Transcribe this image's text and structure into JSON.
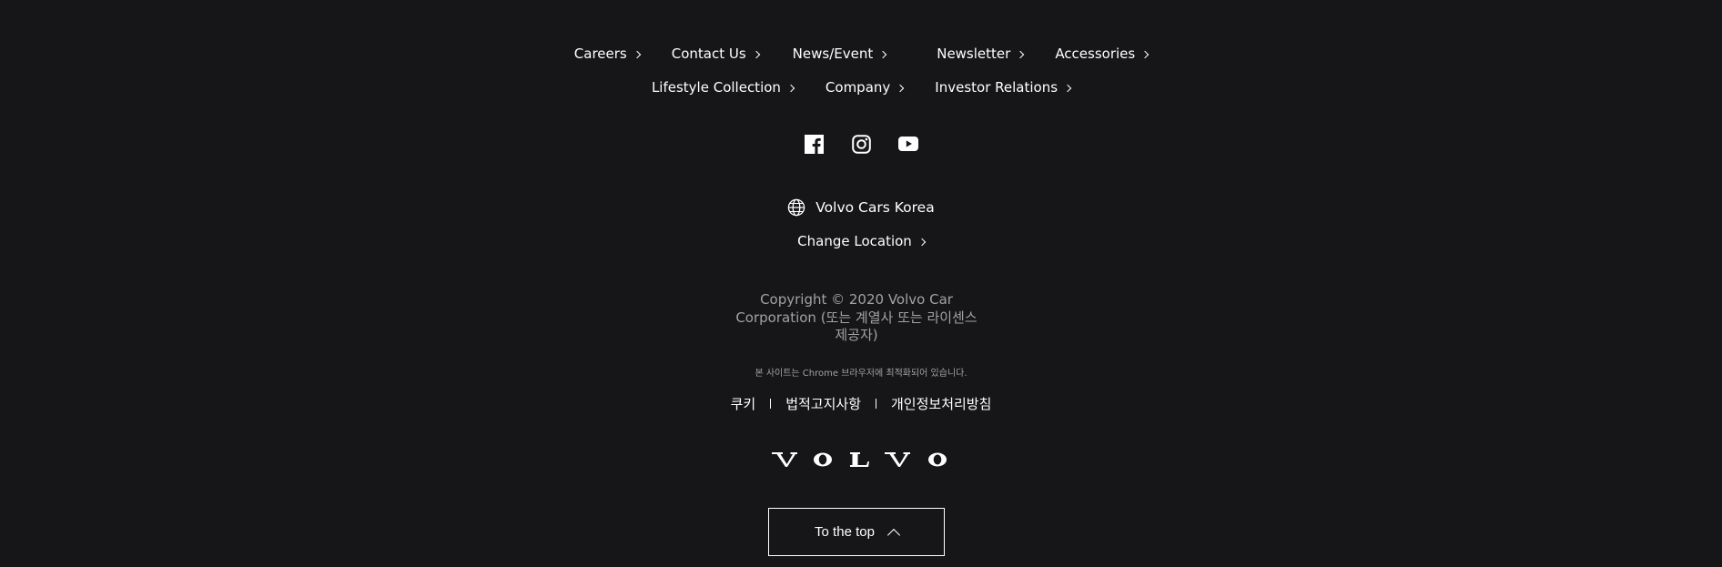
{
  "nav": {
    "row1": [
      {
        "label": "Careers",
        "name": "careers"
      },
      {
        "label": "Contact Us",
        "name": "contact-us"
      },
      {
        "label": "News/Event",
        "name": "news-event"
      },
      {
        "label": "Newsletter",
        "name": "newsletter"
      },
      {
        "label": "Accessories",
        "name": "accessories"
      }
    ],
    "row2": [
      {
        "label": "Lifestyle Collection",
        "name": "lifestyle-collection"
      },
      {
        "label": "Company",
        "name": "company"
      },
      {
        "label": "Investor Relations",
        "name": "investor-relations"
      }
    ]
  },
  "social": [
    "facebook-icon",
    "instagram-icon",
    "youtube-icon"
  ],
  "location": {
    "current": "Volvo Cars Korea",
    "change_label": "Change Location",
    "icon": "globe-icon"
  },
  "copyright": "Copyright © 2020 Volvo Car Corporation (또는 계열사 또는 라이센스 제공자)",
  "optimized_note": "본 사이트는 Chrome 브라우저에 최적화되어 있습니다.",
  "legal": {
    "cookie": "쿠키",
    "notice": "법적고지사항",
    "privacy": "개인정보처리방침"
  },
  "logo_text": "VOLVO",
  "to_top_label": "To the top",
  "colors": {
    "background": "#161618",
    "text": "#ffffff",
    "muted": "#a2a2a4"
  }
}
